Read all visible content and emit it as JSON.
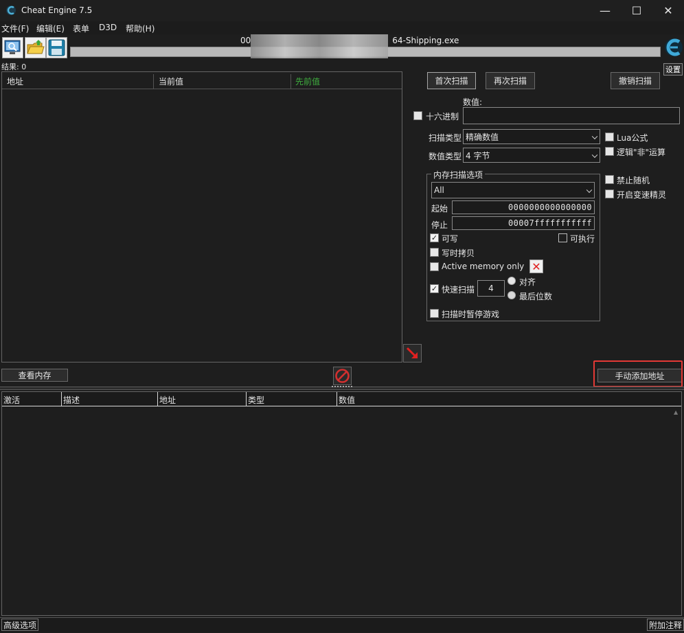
{
  "window": {
    "title": "Cheat Engine 7.5",
    "minimize": "—",
    "maximize": "☐",
    "close": "✕"
  },
  "menu": [
    "文件(F)",
    "编辑(E)",
    "表单",
    "D3D",
    "帮助(H)"
  ],
  "toolbar": {
    "process_prefix": "00",
    "process_suffix": "64-Shipping.exe",
    "settings_label": "设置"
  },
  "results": {
    "label": "结果: 0"
  },
  "result_columns": [
    "地址",
    "当前值",
    "先前值"
  ],
  "scan": {
    "first_scan": "首次扫描",
    "next_scan": "再次扫描",
    "undo_scan": "撤销扫描",
    "value_label": "数值:",
    "value": "",
    "hex_label": "十六进制",
    "scan_type_label": "扫描类型",
    "scan_type": "精确数值",
    "value_type_label": "数值类型",
    "value_type": "4 字节",
    "lua_formula": "Lua公式",
    "not_logic": "逻辑\"非\"运算",
    "disable_random": "禁止随机",
    "speedhack": "开启变速精灵"
  },
  "memory": {
    "group_title": "内存扫描选项",
    "region": "All",
    "start_label": "起始",
    "start_value": "0000000000000000",
    "stop_label": "停止",
    "stop_value": "00007fffffffffff",
    "writable": "可写",
    "executable": "可执行",
    "copy_on_write": "写时拷贝",
    "active_memory": "Active memory only",
    "fast_scan": "快速扫描",
    "fast_scan_value": "4",
    "alignment": "对齐",
    "last_digits": "最后位数",
    "pause_game": "扫描时暂停游戏"
  },
  "buttons": {
    "view_memory": "查看内存",
    "add_address": "手动添加地址"
  },
  "address_columns": [
    "激活",
    "描述",
    "地址",
    "类型",
    "数值"
  ],
  "status": {
    "advanced": "高级选项",
    "annotations": "附加注释"
  },
  "colors": {
    "previous_value_header": "#3fae3f",
    "highlight": "#e53935",
    "accent_red": "#e02020"
  }
}
